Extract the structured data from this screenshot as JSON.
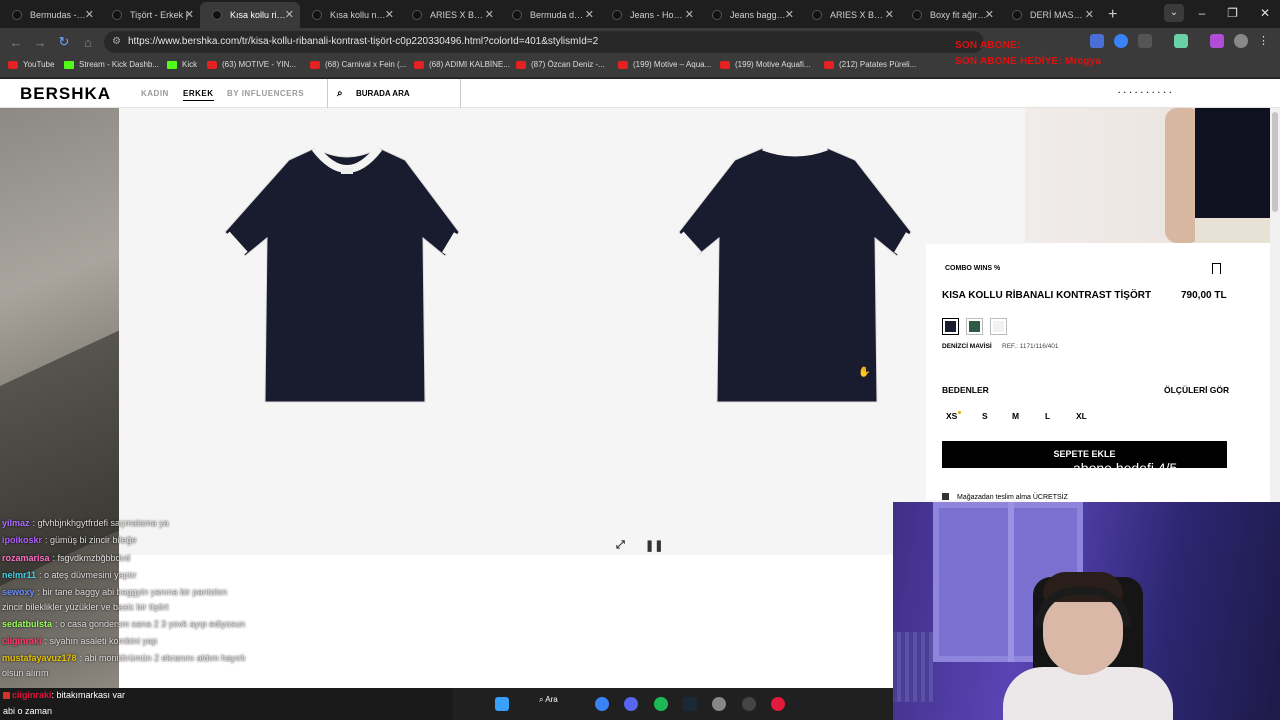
{
  "browser": {
    "tabs": [
      {
        "label": "Bermudas - Ho",
        "active": false
      },
      {
        "label": "Tişört - Erkek |",
        "active": false
      },
      {
        "label": "Kısa kollu ribanı",
        "active": true
      },
      {
        "label": "Kısa kollu nakış",
        "active": false
      },
      {
        "label": "ARIES X BERSH",
        "active": false
      },
      {
        "label": "Bermuda deniz",
        "active": false
      },
      {
        "label": "Jeans - Hombr",
        "active": false
      },
      {
        "label": "Jeans baggy Al",
        "active": false
      },
      {
        "label": "ARIES X BERSH",
        "active": false
      },
      {
        "label": "Boxy fit ağır t-s",
        "active": false
      },
      {
        "label": "DERİ MASKELİ",
        "active": false
      }
    ],
    "url": "https://www.bershka.com/tr/kisa-kollu-ribanali-kontrast-tişört-c0p220330496.html?colorId=401&stylismId=2",
    "bookmarks": [
      {
        "label": "YouTube",
        "icon": "youtube-icon"
      },
      {
        "label": "Stream - Kick Dashb...",
        "icon": "kick-icon"
      },
      {
        "label": "Kick",
        "icon": "kick-icon"
      },
      {
        "label": "(63) MOTIVE - YIN...",
        "icon": "youtube-icon"
      },
      {
        "label": "(68) Carnival x Fein (...",
        "icon": "youtube-icon"
      },
      {
        "label": "(68) ADIMI KALBİNE...",
        "icon": "youtube-icon"
      },
      {
        "label": "(87) Özcan Deniz -...",
        "icon": "youtube-icon"
      },
      {
        "label": "(199) Motive – Aqua...",
        "icon": "youtube-icon"
      },
      {
        "label": "(199) Motive Aquafi...",
        "icon": "youtube-icon"
      },
      {
        "label": "(212) Patates Püreli...",
        "icon": "youtube-icon"
      }
    ]
  },
  "stream_overlay": {
    "last_sub": "SON ABONE: ",
    "last_sub_gift": "SON ABONE HEDİYE: Mrcgya",
    "sub_goal": "abone hedefi 4/5"
  },
  "site": {
    "logo": "BERSHKA",
    "nav": [
      "KADIN",
      "ERKEK",
      "BY INFLUENCERS"
    ],
    "search_placeholder": "BURADA ARA"
  },
  "product": {
    "collection": "COMBO WINS %",
    "name": "KISA KOLLU RİBANALI KONTRAST TİŞÖRT",
    "price": "790,00 TL",
    "colors": [
      "#1b1e2e",
      "#2f5a45",
      "#f2f2f2"
    ],
    "selected_color_name": "DENİZCİ MAVİSİ",
    "ref": "REF.: 1171/116/401",
    "sizes_label": "BEDENLER",
    "size_guide": "ÖLÇÜLERİ GÖR",
    "sizes": [
      "XS",
      "S",
      "M",
      "L",
      "XL"
    ],
    "add_to_cart": "SEPETE EKLE",
    "store_pickup": "Mağazadan teslim alma ÜCRETSİZ"
  },
  "chat": [
    {
      "user": "yilmaz",
      "color": "#a970ff",
      "text": ": gfvhbjnkhgytfrdefi saçmalama ya"
    },
    {
      "user": "ipoikoskr",
      "color": "#b05cff",
      "text": ": gümüş bi zincir bileğe"
    },
    {
      "user": "rozamarisa",
      "color": "#ff6ec7",
      "text": ": fsgvdkmzbğbbdvd"
    },
    {
      "user": "nelmr11",
      "color": "#3fd1e6",
      "text": ": o ateş düvmesini yaptır"
    },
    {
      "user": "sewoxy",
      "color": "#6a8dff",
      "text": ": bir tane baggy abi baggyin yanına bir pantolon"
    },
    {
      "user": "",
      "color": "#ddd",
      "text": "zincir bileklikler yüzükler ve basic bir tişört"
    },
    {
      "user": "sedatbulsta",
      "color": "#9bff5c",
      "text": ": o casa gondersm sana 2 3 yovk ayıp ediyosun"
    },
    {
      "user": "ciiginraki",
      "color": "#ff3b6b",
      "text": ": siyahın asaleti kombini yap"
    },
    {
      "user": "mustafayavuz178",
      "color": "#e6c200",
      "text": ": abi monitörümün 2 ekranını aldım hayırlı"
    },
    {
      "user": "",
      "color": "#ddd",
      "text": "olsun alırım"
    }
  ],
  "chat_bottom": {
    "user": "ciiginraki",
    "text": ": bitakımarkası var",
    "line2": "abi o zaman"
  },
  "taskbar": {
    "search_label": "Ara"
  }
}
